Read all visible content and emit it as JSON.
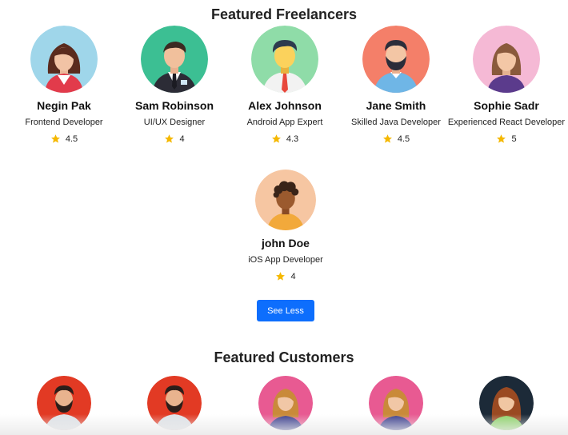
{
  "freelancers_section": {
    "title": "Featured Freelancers",
    "items": [
      {
        "name": "Negin Pak",
        "role": "Frontend Developer",
        "rating": "4.5",
        "avatar_icon": "woman-avatar-icon",
        "bg": "#9fd6ea"
      },
      {
        "name": "Sam Robinson",
        "role": "UI/UX Designer",
        "rating": "4",
        "avatar_icon": "man-suit-avatar-icon",
        "bg": "#3cbf93"
      },
      {
        "name": "Alex Johnson",
        "role": "Android App Expert",
        "rating": "4.3",
        "avatar_icon": "man-tie-avatar-icon",
        "bg": "#8fdca8"
      },
      {
        "name": "Jane Smith",
        "role": "Skilled Java Developer",
        "rating": "4.5",
        "avatar_icon": "bearded-man-avatar-icon",
        "bg": "#f47f69"
      },
      {
        "name": "Sophie Sadr",
        "role": "Experienced React Developer",
        "rating": "5",
        "avatar_icon": "woman-avatar-icon",
        "bg": "#f5b9d5"
      },
      {
        "name": "john Doe",
        "role": "iOS App Developer",
        "rating": "4",
        "avatar_icon": "curly-man-avatar-icon",
        "bg": "#f6c6a2"
      }
    ],
    "toggle_label": "See Less"
  },
  "customers_section": {
    "title": "Featured Customers",
    "avatar_icons": [
      "bearded-man-avatar-icon",
      "bearded-man-avatar-icon",
      "woman-avatar-icon",
      "woman-avatar-icon",
      "woman-avatar-icon"
    ]
  },
  "colors": {
    "accent": "#0d6efd",
    "star": "#f5b800"
  }
}
